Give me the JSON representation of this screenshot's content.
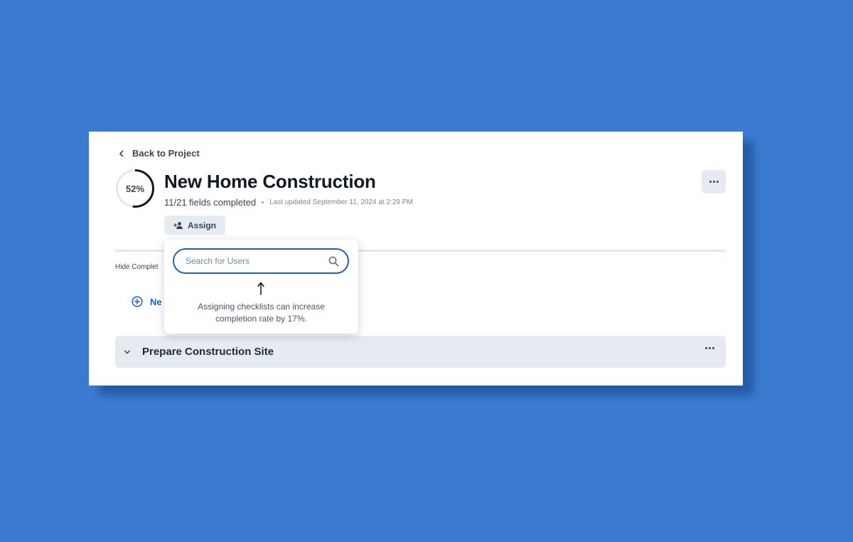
{
  "header": {
    "back_label": "Back to Project",
    "progress_label": "52%",
    "progress_value": 0.52,
    "title": "New Home Construction",
    "fields_completed": "11/21 fields completed",
    "last_updated": "Last updated September 11, 2024 at 2:29 PM",
    "assign_label": "Assign"
  },
  "toolbar": {
    "hide_completed_label": "Hide Complet",
    "new_label": "Ne"
  },
  "popover": {
    "search_placeholder": "Search for Users",
    "hint": "Assigning checklists can increase completion rate by 17%."
  },
  "sections": [
    {
      "title": "Prepare Construction Site"
    }
  ],
  "colors": {
    "background": "#3a7bd1",
    "accent": "#1f5fbf",
    "progress_ring": "#111827",
    "button_bg": "#e6ebf2"
  },
  "icons": [
    "chevron-left-icon",
    "add-user-icon",
    "more-icon",
    "plus-circle-icon",
    "chevron-down-icon",
    "search-icon",
    "arrow-up-icon"
  ]
}
